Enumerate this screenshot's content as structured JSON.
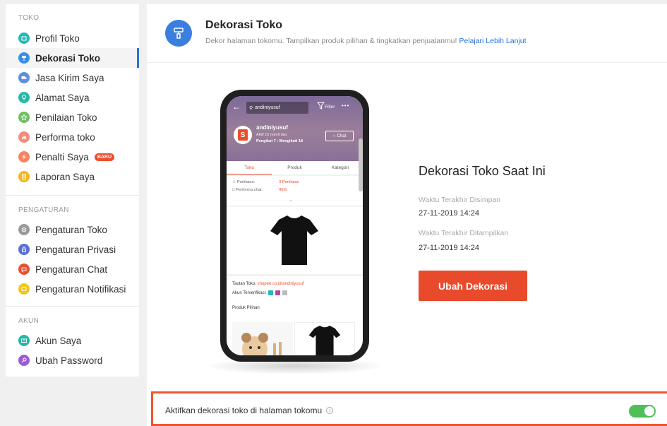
{
  "sidebar": {
    "sections": [
      {
        "label": "TOKO",
        "items": [
          {
            "label": "Profil Toko",
            "color": "#26b8b8"
          },
          {
            "label": "Dekorasi Toko",
            "color": "#3a8ee6",
            "active": true
          },
          {
            "label": "Jasa Kirim Saya",
            "color": "#5b8fe0"
          },
          {
            "label": "Alamat Saya",
            "color": "#26b8a5"
          },
          {
            "label": "Penilaian Toko",
            "color": "#6bc05a"
          },
          {
            "label": "Performa toko",
            "color": "#f58b7a"
          },
          {
            "label": "Penalti Saya",
            "color": "#f5845f",
            "badge": "BARU"
          },
          {
            "label": "Laporan Saya",
            "color": "#f5b51f"
          }
        ]
      },
      {
        "label": "PENGATURAN",
        "items": [
          {
            "label": "Pengaturan Toko",
            "color": "#9a9a9a"
          },
          {
            "label": "Pengaturan Privasi",
            "color": "#5a6ed6"
          },
          {
            "label": "Pengaturan Chat",
            "color": "#ee4d2d"
          },
          {
            "label": "Pengaturan Notifikasi",
            "color": "#f5c518"
          }
        ]
      },
      {
        "label": "AKUN",
        "items": [
          {
            "label": "Akun Saya",
            "color": "#26b8a5"
          },
          {
            "label": "Ubah Password",
            "color": "#9b5bd6"
          }
        ]
      }
    ]
  },
  "header": {
    "title": "Dekorasi Toko",
    "subtitle": "Dekor halaman tokomu. Tampilkan produk pilihan & tingkatkan penjualanmu!",
    "link": "Pelajari Lebih Lanjut",
    "icon_color": "#3a7fdf"
  },
  "phone": {
    "search_text": "andiniyusuf",
    "filter_label": "Filter",
    "shop_name": "andiniyusuf",
    "active_text": "Aktif 15 menit lalu",
    "follow_text": "Pengikut 7 : Mengikuti 18",
    "chat_label": "Chat",
    "tabs": [
      "Toko",
      "Produk",
      "Kategori"
    ],
    "stats": [
      {
        "key": "Penilaian:",
        "value": "3 Penilaian"
      },
      {
        "key": "Performa chat:",
        "value": "45%"
      }
    ],
    "link_label": "Tautan Toko:",
    "link_value": "shopee.co.id/andiniyusuf",
    "verified_label": "Akun Terverifikasi:",
    "featured_label": "Produk Pilihan"
  },
  "current": {
    "title": "Dekorasi Toko Saat Ini",
    "saved_label": "Waktu Terakhir Disimpan",
    "saved_value": "27-11-2019 14:24",
    "shown_label": "Waktu Terakhir Ditampilkan",
    "shown_value": "27-11-2019 14:24",
    "button_label": "Ubah Dekorasi",
    "button_color": "#e84a2b"
  },
  "toggle": {
    "label": "Aktifkan dekorasi toko di halaman tokomu",
    "enabled": true,
    "color": "#4fbf59"
  }
}
